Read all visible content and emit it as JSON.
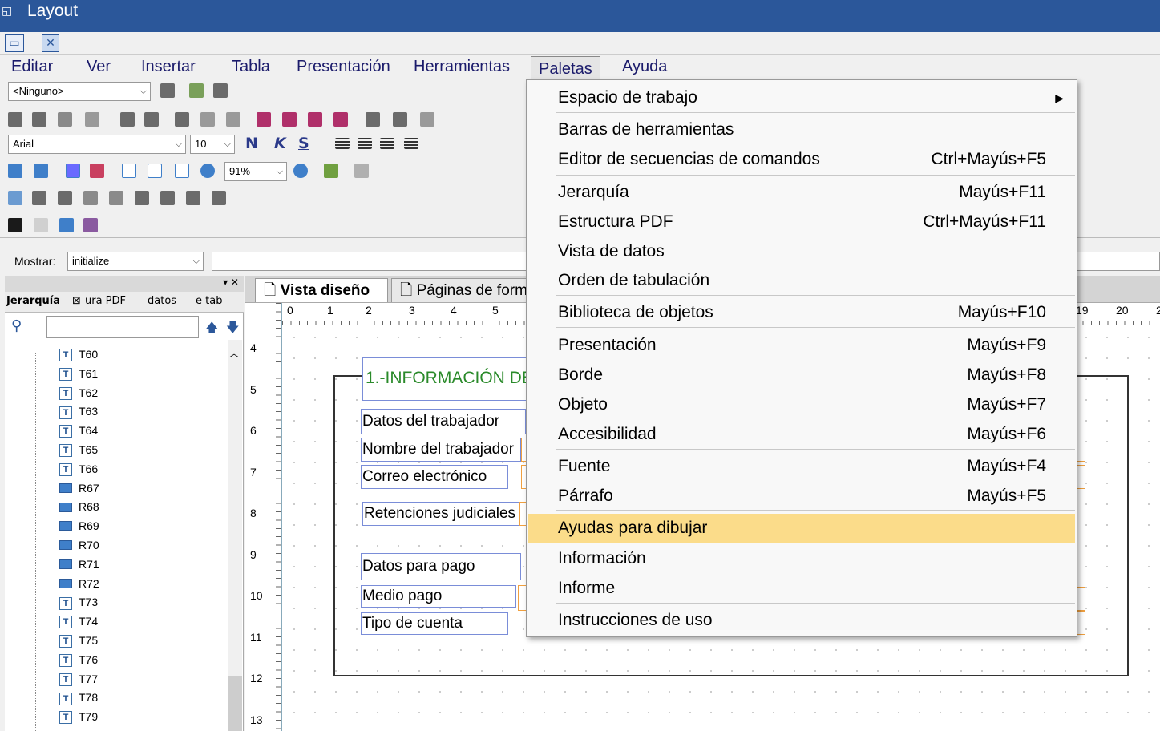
{
  "window": {
    "title": "Layout"
  },
  "menubar": [
    "Editar",
    "Ver",
    "Insertar",
    "Tabla",
    "Presentación",
    "Herramientas",
    "Paletas",
    "Ayuda"
  ],
  "toolbar": {
    "style_select": "<Ninguno>",
    "font_select": "Arial",
    "size_select": "10",
    "bold": "N",
    "italic": "K",
    "underline": "S",
    "zoom_select": "91%"
  },
  "mostrar": {
    "label": "Mostrar:",
    "value": "initialize"
  },
  "left_panel": {
    "tabs": [
      "Jerarquía",
      "ura PDF",
      "datos",
      "e tab"
    ],
    "items": [
      {
        "type": "T",
        "label": "T60"
      },
      {
        "type": "T",
        "label": "T61"
      },
      {
        "type": "T",
        "label": "T62"
      },
      {
        "type": "T",
        "label": "T63"
      },
      {
        "type": "T",
        "label": "T64"
      },
      {
        "type": "T",
        "label": "T65"
      },
      {
        "type": "T",
        "label": "T66"
      },
      {
        "type": "R",
        "label": "R67"
      },
      {
        "type": "R",
        "label": "R68"
      },
      {
        "type": "R",
        "label": "R69"
      },
      {
        "type": "R",
        "label": "R70"
      },
      {
        "type": "R",
        "label": "R71"
      },
      {
        "type": "R",
        "label": "R72"
      },
      {
        "type": "T",
        "label": "T73"
      },
      {
        "type": "T",
        "label": "T74"
      },
      {
        "type": "T",
        "label": "T75"
      },
      {
        "type": "T",
        "label": "T76"
      },
      {
        "type": "T",
        "label": "T77"
      },
      {
        "type": "T",
        "label": "T78"
      },
      {
        "type": "T",
        "label": "T79"
      }
    ]
  },
  "doc_tabs": [
    "Vista diseño",
    "Páginas de form"
  ],
  "ruler": {
    "h": [
      "0",
      "1",
      "2",
      "3",
      "4",
      "5",
      "19",
      "20",
      "2"
    ],
    "v": [
      "4",
      "5",
      "6",
      "7",
      "8",
      "9",
      "10",
      "11",
      "12",
      "13"
    ]
  },
  "design": {
    "section_title": "1.-INFORMACIÓN DE",
    "fields": [
      "Datos del trabajador",
      "Nombre del trabajador",
      "Correo electrónico",
      "Retenciones judiciales",
      "Datos para pago",
      "Medio pago",
      "Tipo de cuenta"
    ]
  },
  "paletas_menu": [
    {
      "label": "Espacio de trabajo",
      "shortcut": "",
      "submenu": true
    },
    {
      "label": "Barras de herramientas",
      "shortcut": ""
    },
    {
      "label": "Editor de secuencias de comandos",
      "shortcut": "Ctrl+Mayús+F5"
    },
    {
      "label": "Jerarquía",
      "shortcut": "Mayús+F11"
    },
    {
      "label": "Estructura PDF",
      "shortcut": "Ctrl+Mayús+F11"
    },
    {
      "label": "Vista de datos",
      "shortcut": ""
    },
    {
      "label": "Orden de tabulación",
      "shortcut": ""
    },
    {
      "label": "Biblioteca de objetos",
      "shortcut": "Mayús+F10"
    },
    {
      "label": "Presentación",
      "shortcut": "Mayús+F9"
    },
    {
      "label": "Borde",
      "shortcut": "Mayús+F8"
    },
    {
      "label": "Objeto",
      "shortcut": "Mayús+F7"
    },
    {
      "label": "Accesibilidad",
      "shortcut": "Mayús+F6"
    },
    {
      "label": "Fuente",
      "shortcut": "Mayús+F4"
    },
    {
      "label": "Párrafo",
      "shortcut": "Mayús+F5"
    },
    {
      "label": "Ayudas para dibujar",
      "shortcut": "",
      "highlighted": true
    },
    {
      "label": "Información",
      "shortcut": ""
    },
    {
      "label": "Informe",
      "shortcut": ""
    },
    {
      "label": "Instrucciones de uso",
      "shortcut": ""
    }
  ]
}
